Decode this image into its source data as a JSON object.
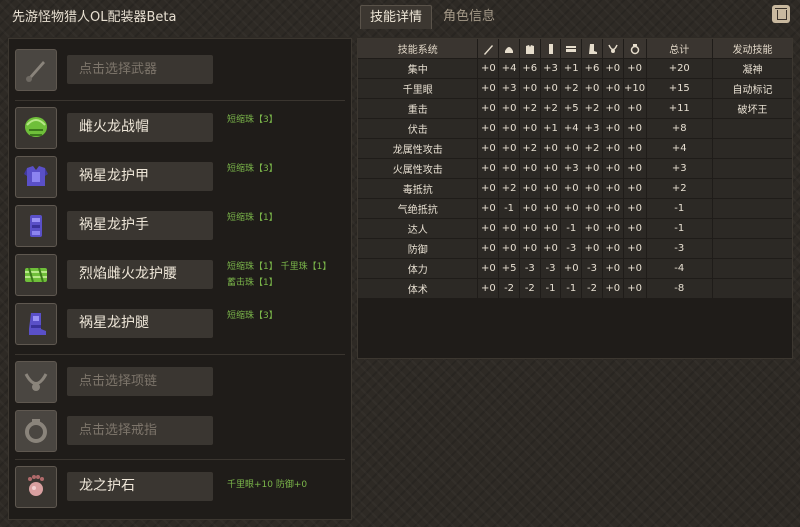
{
  "app": {
    "title": "先游怪物猎人OL配装器Beta"
  },
  "tabs": [
    {
      "label": "技能详情"
    },
    {
      "label": "角色信息"
    }
  ],
  "equipment": [
    {
      "name": "点击选择武器",
      "empty": true,
      "icon": "weapon-placeholder",
      "decos": []
    },
    {
      "name": "雌火龙战帽",
      "empty": false,
      "icon": "helmet",
      "decos": [
        "短缩珠【3】"
      ]
    },
    {
      "name": "祸星龙护甲",
      "empty": false,
      "icon": "chest-armor",
      "decos": [
        "短缩珠【3】"
      ]
    },
    {
      "name": "祸星龙护手",
      "empty": false,
      "icon": "gauntlet",
      "decos": [
        "短缩珠【1】"
      ]
    },
    {
      "name": "烈焰雌火龙护腰",
      "empty": false,
      "icon": "waist",
      "decos": [
        "短缩珠【1】  千里珠【1】",
        "蓄击珠【1】"
      ]
    },
    {
      "name": "祸星龙护腿",
      "empty": false,
      "icon": "leg-armor",
      "decos": [
        "短缩珠【3】"
      ]
    },
    {
      "name": "点击选择项链",
      "empty": true,
      "icon": "necklace-placeholder",
      "decos": []
    },
    {
      "name": "点击选择戒指",
      "empty": true,
      "icon": "ring-placeholder",
      "decos": []
    },
    {
      "name": "龙之护石",
      "empty": false,
      "icon": "charm",
      "decos": [
        "千里眼+10  防御+0"
      ]
    }
  ],
  "skills_table": {
    "headers": {
      "name": "技能系统",
      "total": "总计",
      "active": "发动技能",
      "slot_icons": [
        "weapon-icon",
        "helmet-icon",
        "chest-icon",
        "arm-icon",
        "waist-icon",
        "leg-icon",
        "necklace-icon",
        "ring-icon"
      ]
    },
    "rows": [
      {
        "name": "集中",
        "values": [
          "+0",
          "+4",
          "+6",
          "+3",
          "+1",
          "+6",
          "+0",
          "+0"
        ],
        "total": "+20",
        "active": "凝神"
      },
      {
        "name": "千里眼",
        "values": [
          "+0",
          "+3",
          "+0",
          "+0",
          "+2",
          "+0",
          "+0",
          "+10"
        ],
        "total": "+15",
        "active": "自动标记"
      },
      {
        "name": "重击",
        "values": [
          "+0",
          "+0",
          "+2",
          "+2",
          "+5",
          "+2",
          "+0",
          "+0"
        ],
        "total": "+11",
        "active": "破坏王"
      },
      {
        "name": "伏击",
        "values": [
          "+0",
          "+0",
          "+0",
          "+1",
          "+4",
          "+3",
          "+0",
          "+0"
        ],
        "total": "+8",
        "active": ""
      },
      {
        "name": "龙属性攻击",
        "values": [
          "+0",
          "+0",
          "+2",
          "+0",
          "+0",
          "+2",
          "+0",
          "+0"
        ],
        "total": "+4",
        "active": ""
      },
      {
        "name": "火属性攻击",
        "values": [
          "+0",
          "+0",
          "+0",
          "+0",
          "+3",
          "+0",
          "+0",
          "+0"
        ],
        "total": "+3",
        "active": ""
      },
      {
        "name": "毒抵抗",
        "values": [
          "+0",
          "+2",
          "+0",
          "+0",
          "+0",
          "+0",
          "+0",
          "+0"
        ],
        "total": "+2",
        "active": ""
      },
      {
        "name": "气绝抵抗",
        "values": [
          "+0",
          "-1",
          "+0",
          "+0",
          "+0",
          "+0",
          "+0",
          "+0"
        ],
        "total": "-1",
        "active": ""
      },
      {
        "name": "达人",
        "values": [
          "+0",
          "+0",
          "+0",
          "+0",
          "-1",
          "+0",
          "+0",
          "+0"
        ],
        "total": "-1",
        "active": ""
      },
      {
        "name": "防御",
        "values": [
          "+0",
          "+0",
          "+0",
          "+0",
          "-3",
          "+0",
          "+0",
          "+0"
        ],
        "total": "-3",
        "active": ""
      },
      {
        "name": "体力",
        "values": [
          "+0",
          "+5",
          "-3",
          "-3",
          "+0",
          "-3",
          "+0",
          "+0"
        ],
        "total": "-4",
        "active": ""
      },
      {
        "name": "体术",
        "values": [
          "+0",
          "-2",
          "-2",
          "-1",
          "-1",
          "-2",
          "+0",
          "+0"
        ],
        "total": "-8",
        "active": ""
      }
    ]
  },
  "colors": {
    "accent_green": "#7bb64a",
    "panel_bg": "#1f1c19",
    "slot_bg": "#3a3631"
  }
}
